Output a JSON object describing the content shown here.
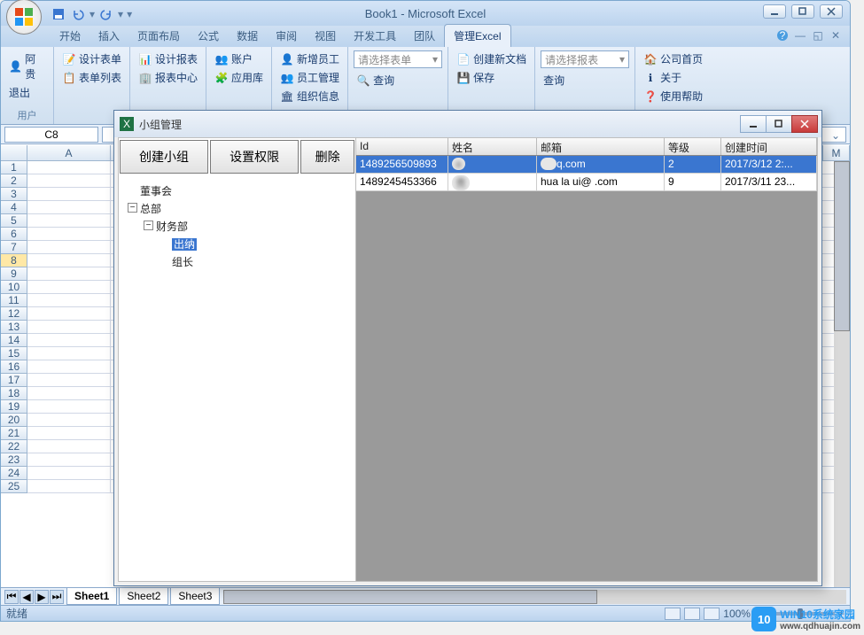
{
  "app": {
    "title": "Book1 - Microsoft Excel"
  },
  "tabs": [
    "开始",
    "插入",
    "页面布局",
    "公式",
    "数据",
    "审阅",
    "视图",
    "开发工具",
    "团队",
    "管理Excel"
  ],
  "active_tab": 9,
  "ribbon": {
    "group1": {
      "label": "用户",
      "items": [
        "阿贵",
        "退出"
      ]
    },
    "group2": {
      "items": [
        "设计表单",
        "表单列表"
      ]
    },
    "group3": {
      "items": [
        "设计报表",
        "报表中心"
      ]
    },
    "group4": {
      "items": [
        "账户",
        "应用库"
      ]
    },
    "group5": {
      "items": [
        "新增员工",
        "员工管理",
        "组织信息"
      ]
    },
    "group6": {
      "combo": "请选择表单",
      "btn": "查询"
    },
    "group7": {
      "items": [
        "创建新文档",
        "保存"
      ]
    },
    "group8": {
      "combo": "请选择报表",
      "btn": "查询"
    },
    "group9": {
      "items": [
        "公司首页",
        "关于",
        "使用帮助"
      ]
    }
  },
  "namebox": "C8",
  "columns": [
    "A",
    "M"
  ],
  "sheets": [
    "Sheet1",
    "Sheet2",
    "Sheet3"
  ],
  "status": {
    "left": "就绪",
    "zoom": "100%"
  },
  "dialog": {
    "title": "小组管理",
    "buttons": [
      "创建小组",
      "设置权限",
      "删除"
    ],
    "tree": {
      "root1": "董事会",
      "root2": "总部",
      "child1": "财务部",
      "leaf1": "出纳",
      "leaf2": "组长"
    },
    "table": {
      "headers": [
        "Id",
        "姓名",
        "邮箱",
        "等级",
        "创建时间"
      ],
      "rows": [
        {
          "id": "1489256509893",
          "name": "a",
          "email": "q.com",
          "level": "2",
          "time": "2017/3/12 2:..."
        },
        {
          "id": "1489245453366",
          "name": "贵",
          "email": "hua   la   ui@   .com",
          "level": "9",
          "time": "2017/3/11 23..."
        }
      ]
    }
  },
  "watermark": {
    "logo": "10",
    "line1": "WIN10系统家园",
    "line2": "www.qdhuajin.com"
  }
}
